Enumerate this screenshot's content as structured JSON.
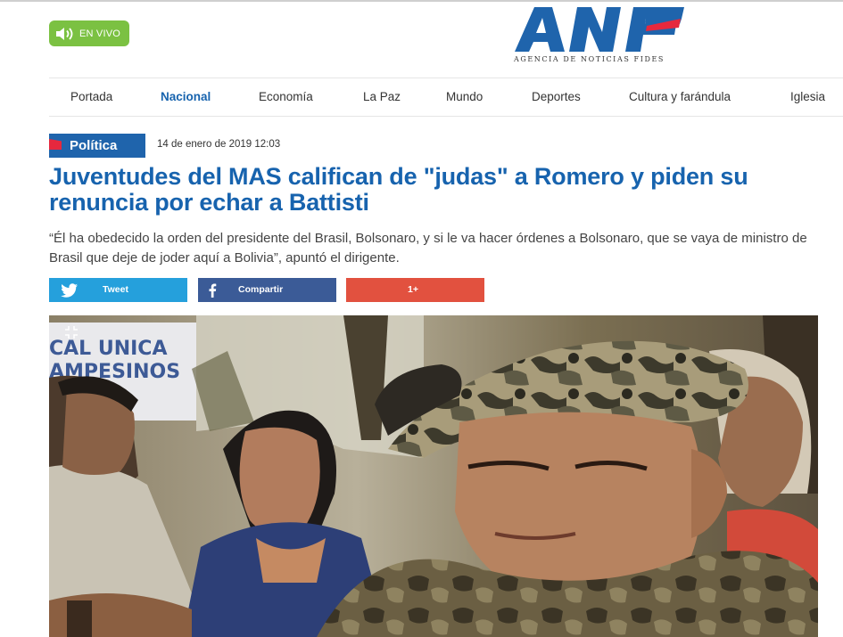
{
  "header": {
    "live_label": "EN VIVO",
    "logo_text": "ANF",
    "logo_subtitle": "AGENCIA DE NOTICIAS FIDES"
  },
  "nav": {
    "items": [
      "Portada",
      "Nacional",
      "Economía",
      "La Paz",
      "Mundo",
      "Deportes",
      "Cultura y farándula",
      "Iglesia"
    ],
    "active": "Nacional"
  },
  "article": {
    "category": "Política",
    "date": "14 de enero de 2019 12:03",
    "headline": "Juventudes del MAS califican de \"judas\" a Romero y piden su renuncia por echar a Battisti",
    "lead": "“Él ha obedecido la orden del presidente del Brasil, Bolsonaro, y si le va hacer órdenes a Bolsonaro, que se vaya de ministro de Brasil que deje de joder aquí a Bolivia”, apuntó el dirigente."
  },
  "share": {
    "twitter_label": "Tweet",
    "facebook_label": "Compartir",
    "google_label": "1+"
  },
  "photo": {
    "sign_line1": "CAL UNICA",
    "sign_line2": "AMPESINOS",
    "expand_icon": "expand-icon"
  },
  "colors": {
    "brand_blue": "#1763ae",
    "brand_red": "#e6283e",
    "live_green": "#7bc142",
    "twitter": "#25a0dc",
    "facebook": "#3b5b97",
    "google": "#e2513f"
  }
}
